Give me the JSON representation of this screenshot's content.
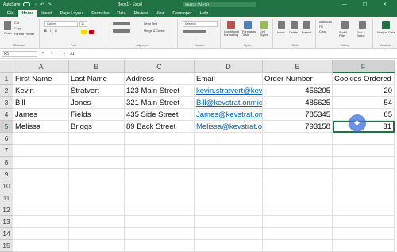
{
  "titlebar": {
    "autosave": "AutoSave",
    "toggle": "Off",
    "quick_access": "▫ ↶ ↷",
    "doc_title": "Book1 - Excel",
    "search_placeholder": "Search (Alt+Q)",
    "window_buttons": "— ▢ ✕"
  },
  "ribbon_tabs": [
    "File",
    "Home",
    "Insert",
    "Page Layout",
    "Formulas",
    "Data",
    "Review",
    "View",
    "Developer",
    "Help"
  ],
  "active_tab": "Home",
  "ribbon": {
    "paste": "Paste",
    "cut": "Cut",
    "copy": "Copy",
    "format_painter": "Format Painter",
    "clipboard": "Clipboard",
    "font_name": "Calibri",
    "font_size": "11",
    "font": "Font",
    "wrap_text": "Wrap Text",
    "merge_center": "Merge & Center",
    "alignment": "Alignment",
    "number_format": "General",
    "number": "Number",
    "conditional_formatting": "Conditional Formatting",
    "format_as_table": "Format as Table",
    "cell_styles": "Cell Styles",
    "styles": "Styles",
    "insert": "Insert",
    "delete": "Delete",
    "format": "Format",
    "cells": "Cells",
    "autosum": "AutoSum",
    "fill": "Fill",
    "clear": "Clear",
    "sort_filter": "Sort & Filter",
    "find_select": "Find & Select",
    "analyze_data": "Analyze Data",
    "editing": "Editing",
    "analysis": "Analysis"
  },
  "formula_bar": {
    "name_box": "F5",
    "fx_icons": "✕ ✓ fx",
    "value": "31"
  },
  "columns": [
    "A",
    "B",
    "C",
    "D",
    "E",
    "F"
  ],
  "selected_column": "F",
  "rows": [
    "1",
    "2",
    "3",
    "4",
    "5",
    "6",
    "7",
    "8",
    "9",
    "10",
    "11",
    "12",
    "13",
    "14",
    "15"
  ],
  "selected_row": "5",
  "table": [
    [
      "First Name",
      "Last Name",
      "Address",
      "Email",
      "Order Number",
      "Cookies Ordered"
    ],
    [
      "Kevin",
      "Stratvert",
      "123 Main Street",
      "kevin.stratvert@kev",
      "456205",
      "20"
    ],
    [
      "Bill",
      "Jones",
      "321 Main Street",
      "Bill@kevstrat.onmic",
      "485625",
      "54"
    ],
    [
      "James",
      "Fields",
      "435 Side Street",
      "James@kevstrat.on",
      "785345",
      "65"
    ],
    [
      "Melissa",
      "Briggs",
      "89 Back Street",
      "Melissa@kevstrat.on",
      "793158",
      "31"
    ]
  ],
  "accent_color": "#217346"
}
